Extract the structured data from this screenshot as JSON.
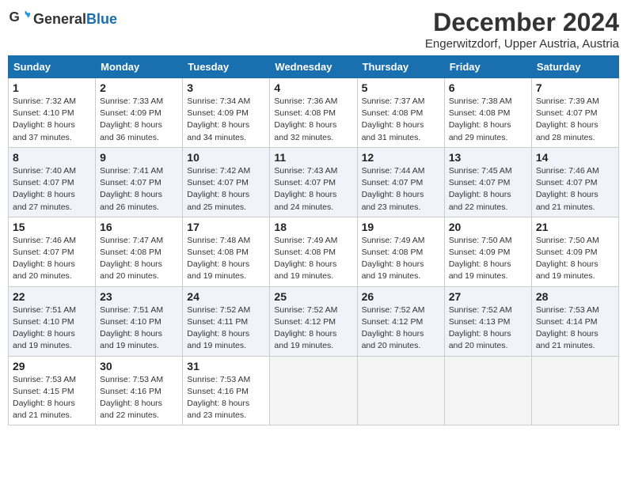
{
  "header": {
    "logo_general": "General",
    "logo_blue": "Blue",
    "month_title": "December 2024",
    "subtitle": "Engerwitzdorf, Upper Austria, Austria"
  },
  "weekdays": [
    "Sunday",
    "Monday",
    "Tuesday",
    "Wednesday",
    "Thursday",
    "Friday",
    "Saturday"
  ],
  "weeks": [
    [
      {
        "day": "1",
        "sunrise": "Sunrise: 7:32 AM",
        "sunset": "Sunset: 4:10 PM",
        "daylight": "Daylight: 8 hours and 37 minutes."
      },
      {
        "day": "2",
        "sunrise": "Sunrise: 7:33 AM",
        "sunset": "Sunset: 4:09 PM",
        "daylight": "Daylight: 8 hours and 36 minutes."
      },
      {
        "day": "3",
        "sunrise": "Sunrise: 7:34 AM",
        "sunset": "Sunset: 4:09 PM",
        "daylight": "Daylight: 8 hours and 34 minutes."
      },
      {
        "day": "4",
        "sunrise": "Sunrise: 7:36 AM",
        "sunset": "Sunset: 4:08 PM",
        "daylight": "Daylight: 8 hours and 32 minutes."
      },
      {
        "day": "5",
        "sunrise": "Sunrise: 7:37 AM",
        "sunset": "Sunset: 4:08 PM",
        "daylight": "Daylight: 8 hours and 31 minutes."
      },
      {
        "day": "6",
        "sunrise": "Sunrise: 7:38 AM",
        "sunset": "Sunset: 4:08 PM",
        "daylight": "Daylight: 8 hours and 29 minutes."
      },
      {
        "day": "7",
        "sunrise": "Sunrise: 7:39 AM",
        "sunset": "Sunset: 4:07 PM",
        "daylight": "Daylight: 8 hours and 28 minutes."
      }
    ],
    [
      {
        "day": "8",
        "sunrise": "Sunrise: 7:40 AM",
        "sunset": "Sunset: 4:07 PM",
        "daylight": "Daylight: 8 hours and 27 minutes."
      },
      {
        "day": "9",
        "sunrise": "Sunrise: 7:41 AM",
        "sunset": "Sunset: 4:07 PM",
        "daylight": "Daylight: 8 hours and 26 minutes."
      },
      {
        "day": "10",
        "sunrise": "Sunrise: 7:42 AM",
        "sunset": "Sunset: 4:07 PM",
        "daylight": "Daylight: 8 hours and 25 minutes."
      },
      {
        "day": "11",
        "sunrise": "Sunrise: 7:43 AM",
        "sunset": "Sunset: 4:07 PM",
        "daylight": "Daylight: 8 hours and 24 minutes."
      },
      {
        "day": "12",
        "sunrise": "Sunrise: 7:44 AM",
        "sunset": "Sunset: 4:07 PM",
        "daylight": "Daylight: 8 hours and 23 minutes."
      },
      {
        "day": "13",
        "sunrise": "Sunrise: 7:45 AM",
        "sunset": "Sunset: 4:07 PM",
        "daylight": "Daylight: 8 hours and 22 minutes."
      },
      {
        "day": "14",
        "sunrise": "Sunrise: 7:46 AM",
        "sunset": "Sunset: 4:07 PM",
        "daylight": "Daylight: 8 hours and 21 minutes."
      }
    ],
    [
      {
        "day": "15",
        "sunrise": "Sunrise: 7:46 AM",
        "sunset": "Sunset: 4:07 PM",
        "daylight": "Daylight: 8 hours and 20 minutes."
      },
      {
        "day": "16",
        "sunrise": "Sunrise: 7:47 AM",
        "sunset": "Sunset: 4:08 PM",
        "daylight": "Daylight: 8 hours and 20 minutes."
      },
      {
        "day": "17",
        "sunrise": "Sunrise: 7:48 AM",
        "sunset": "Sunset: 4:08 PM",
        "daylight": "Daylight: 8 hours and 19 minutes."
      },
      {
        "day": "18",
        "sunrise": "Sunrise: 7:49 AM",
        "sunset": "Sunset: 4:08 PM",
        "daylight": "Daylight: 8 hours and 19 minutes."
      },
      {
        "day": "19",
        "sunrise": "Sunrise: 7:49 AM",
        "sunset": "Sunset: 4:08 PM",
        "daylight": "Daylight: 8 hours and 19 minutes."
      },
      {
        "day": "20",
        "sunrise": "Sunrise: 7:50 AM",
        "sunset": "Sunset: 4:09 PM",
        "daylight": "Daylight: 8 hours and 19 minutes."
      },
      {
        "day": "21",
        "sunrise": "Sunrise: 7:50 AM",
        "sunset": "Sunset: 4:09 PM",
        "daylight": "Daylight: 8 hours and 19 minutes."
      }
    ],
    [
      {
        "day": "22",
        "sunrise": "Sunrise: 7:51 AM",
        "sunset": "Sunset: 4:10 PM",
        "daylight": "Daylight: 8 hours and 19 minutes."
      },
      {
        "day": "23",
        "sunrise": "Sunrise: 7:51 AM",
        "sunset": "Sunset: 4:10 PM",
        "daylight": "Daylight: 8 hours and 19 minutes."
      },
      {
        "day": "24",
        "sunrise": "Sunrise: 7:52 AM",
        "sunset": "Sunset: 4:11 PM",
        "daylight": "Daylight: 8 hours and 19 minutes."
      },
      {
        "day": "25",
        "sunrise": "Sunrise: 7:52 AM",
        "sunset": "Sunset: 4:12 PM",
        "daylight": "Daylight: 8 hours and 19 minutes."
      },
      {
        "day": "26",
        "sunrise": "Sunrise: 7:52 AM",
        "sunset": "Sunset: 4:12 PM",
        "daylight": "Daylight: 8 hours and 20 minutes."
      },
      {
        "day": "27",
        "sunrise": "Sunrise: 7:52 AM",
        "sunset": "Sunset: 4:13 PM",
        "daylight": "Daylight: 8 hours and 20 minutes."
      },
      {
        "day": "28",
        "sunrise": "Sunrise: 7:53 AM",
        "sunset": "Sunset: 4:14 PM",
        "daylight": "Daylight: 8 hours and 21 minutes."
      }
    ],
    [
      {
        "day": "29",
        "sunrise": "Sunrise: 7:53 AM",
        "sunset": "Sunset: 4:15 PM",
        "daylight": "Daylight: 8 hours and 21 minutes."
      },
      {
        "day": "30",
        "sunrise": "Sunrise: 7:53 AM",
        "sunset": "Sunset: 4:16 PM",
        "daylight": "Daylight: 8 hours and 22 minutes."
      },
      {
        "day": "31",
        "sunrise": "Sunrise: 7:53 AM",
        "sunset": "Sunset: 4:16 PM",
        "daylight": "Daylight: 8 hours and 23 minutes."
      },
      null,
      null,
      null,
      null
    ]
  ]
}
